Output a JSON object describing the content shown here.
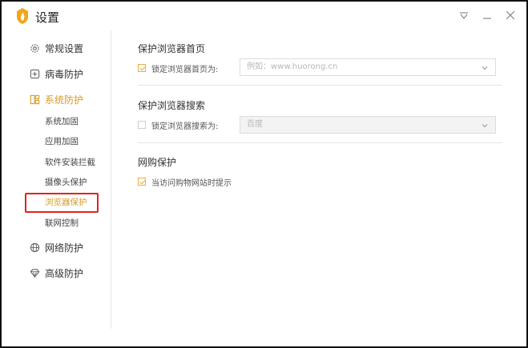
{
  "window": {
    "title": "设置"
  },
  "sidebar": {
    "items": [
      {
        "label": "常规设置",
        "icon": "gear-icon"
      },
      {
        "label": "病毒防护",
        "icon": "plus-square-icon"
      },
      {
        "label": "系统防护",
        "icon": "system-grid-icon",
        "active": true
      },
      {
        "label": "网络防护",
        "icon": "globe-icon"
      },
      {
        "label": "高级防护",
        "icon": "diamond-icon"
      }
    ],
    "sub_items": [
      "系统加固",
      "应用加固",
      "软件安装拦截",
      "摄像头保护",
      "浏览器保护",
      "联网控制"
    ],
    "selected_sub": "浏览器保护"
  },
  "main": {
    "homepage": {
      "title": "保护浏览器首页",
      "checkbox_label": "锁定浏览器首页为:",
      "checked": true,
      "placeholder": "例如：www.huorong.cn"
    },
    "search": {
      "title": "保护浏览器搜索",
      "checkbox_label": "锁定浏览器搜索为:",
      "checked": false,
      "value": "百度"
    },
    "shopping": {
      "title": "网购保护",
      "checkbox_label": "当访问购物网站时提示",
      "checked": true
    }
  },
  "colors": {
    "accent": "#d89b28",
    "highlight": "#e0231f"
  }
}
